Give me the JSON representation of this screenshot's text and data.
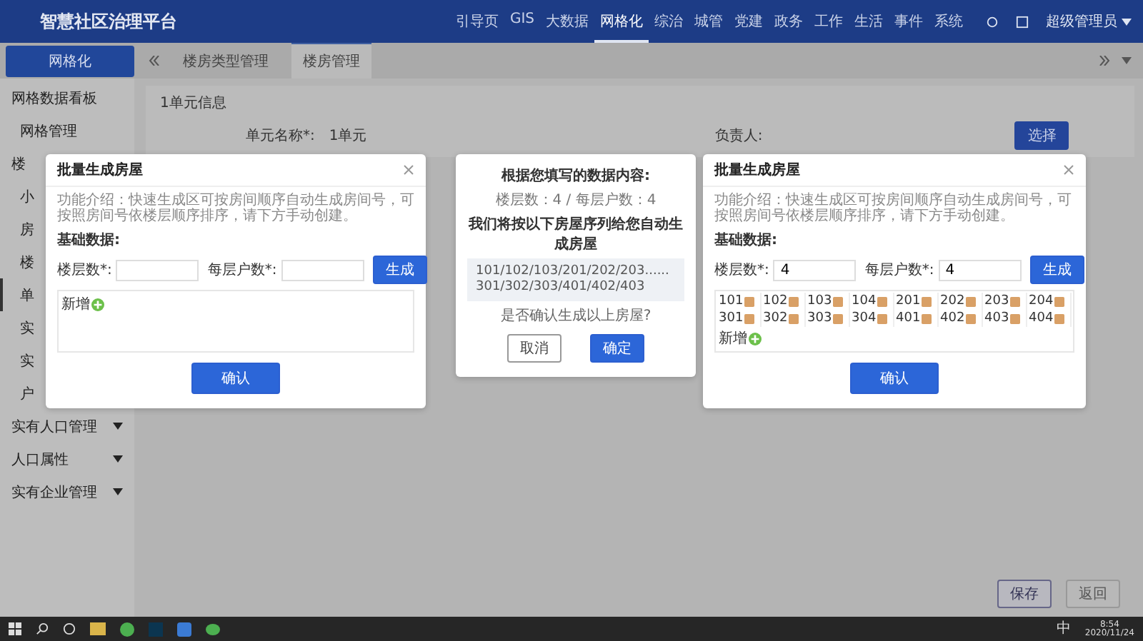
{
  "header": {
    "title": "智慧社区治理平台",
    "nav": [
      {
        "label": "引导页",
        "selected": false
      },
      {
        "label": "GIS",
        "selected": false
      },
      {
        "label": "大数据",
        "selected": false
      },
      {
        "label": "网格化",
        "selected": true
      },
      {
        "label": "综治",
        "selected": false
      },
      {
        "label": "城管",
        "selected": false
      },
      {
        "label": "党建",
        "selected": false
      },
      {
        "label": "政务",
        "selected": false
      },
      {
        "label": "工作",
        "selected": false
      },
      {
        "label": "生活",
        "selected": false
      },
      {
        "label": "事件",
        "selected": false
      },
      {
        "label": "系统",
        "selected": false
      }
    ],
    "user": "超级管理员"
  },
  "sidebar": {
    "title": "网格化",
    "items": [
      {
        "label": "网格数据看板",
        "kind": "group",
        "selected": false
      },
      {
        "label": "网格管理",
        "kind": "item",
        "selected": false
      },
      {
        "label": "楼",
        "kind": "group",
        "selected": false
      },
      {
        "label": "小",
        "kind": "item",
        "selected": false
      },
      {
        "label": "房",
        "kind": "item",
        "selected": false
      },
      {
        "label": "楼",
        "kind": "item",
        "selected": false
      },
      {
        "label": "单",
        "kind": "item",
        "selected": true
      },
      {
        "label": "实",
        "kind": "item",
        "selected": false
      },
      {
        "label": "实",
        "kind": "item",
        "selected": false
      },
      {
        "label": "户",
        "kind": "item",
        "selected": false
      },
      {
        "label": "实有人口管理",
        "kind": "menu",
        "selected": false
      },
      {
        "label": "人口属性",
        "kind": "menu",
        "selected": false
      },
      {
        "label": "实有企业管理",
        "kind": "menu",
        "selected": false
      }
    ]
  },
  "tabs": [
    {
      "label": "楼房类型管理",
      "selected": false
    },
    {
      "label": "楼房管理",
      "selected": true
    }
  ],
  "unit_form": {
    "title": "1单元信息",
    "name_label": "单元名称*:",
    "name_value": "1单元",
    "owner_label": "负责人:",
    "select_button": "选择"
  },
  "footer_buttons": [
    {
      "label": "保存",
      "kind": "primary"
    },
    {
      "label": "返回",
      "kind": "plain"
    }
  ],
  "dialogs": [
    {
      "kind": "generator",
      "title": "批量生成房屋",
      "intro": "功能介绍：快速生成区可按房间顺序自动生成房间号，可按照房间号依楼层顺序排序，请下方手动创建。",
      "section": "基础数据:",
      "floors_label": "楼层数*:",
      "units_label": "每层户数*:",
      "generate_button": "生成",
      "add_label": "新增",
      "confirm_button": "确认"
    },
    {
      "kind": "confirm",
      "line_1": "根据您填写的数据内容:",
      "line_2": "楼层数：4 / 每层户数：4",
      "line_3": "我们将按以下房屋序列给您自动生成房屋",
      "sequence": "101/102/103/201/202/203......301/302/303/401/402/403",
      "question": "是否确认生成以上房屋?",
      "cancel_button": "取消",
      "ok_button": "确定"
    },
    {
      "kind": "generator",
      "title": "批量生成房屋",
      "intro": "功能介绍：快速生成区可按房间顺序自动生成房间号，可按照房间号依楼层顺序排序，请下方手动创建。",
      "section": "基础数据:",
      "floors_label": "楼层数*:",
      "floors_value": "4",
      "units_label": "每层户数*:",
      "units_value": "4",
      "generate_button": "生成",
      "rooms": [
        "101",
        "102",
        "103",
        "104",
        "201",
        "202",
        "203",
        "204",
        "301",
        "302",
        "303",
        "304",
        "401",
        "402",
        "403",
        "404"
      ],
      "add_label": "新增",
      "confirm_button": "确认"
    }
  ],
  "taskbar": {
    "ime": "中",
    "time": "8:54",
    "date": "2020/11/24"
  }
}
